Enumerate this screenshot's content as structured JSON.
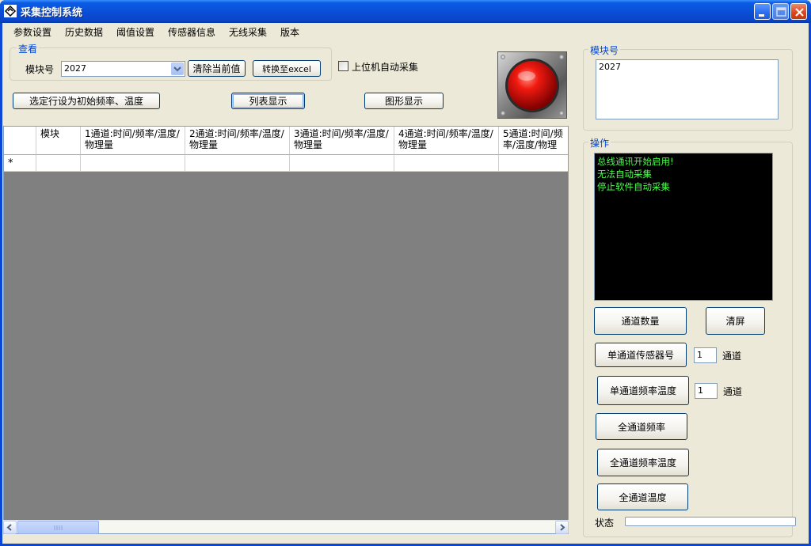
{
  "window": {
    "title": "采集控制系统"
  },
  "menu": [
    "参数设置",
    "历史数据",
    "阈值设置",
    "传感器信息",
    "无线采集",
    "版本"
  ],
  "view_group": {
    "label": "查看",
    "module_label": "模块号",
    "module_value": "2027",
    "clear_button": "清除当前值",
    "excel_button": "转换至excel",
    "auto_collect_label": "上位机自动采集",
    "auto_collect_checked": false
  },
  "buttons": {
    "set_initial": "选定行设为初始频率、温度",
    "list_view": "列表显示",
    "graph_view": "图形显示"
  },
  "grid": {
    "columns": [
      "模块",
      "1通道:时间/频率/温度/物理量",
      "2通道:时间/频率/温度/物理量",
      "3通道:时间/频率/温度/物理量",
      "4通道:时间/频率/温度/物理量",
      "5通道:时间/频率/温度/物理"
    ],
    "new_row_marker": "*"
  },
  "module_panel": {
    "label": "模块号",
    "value": "2027"
  },
  "operation": {
    "label": "操作",
    "log": [
      "总线通讯开始启用!",
      "无法自动采集",
      "停止软件自动采集"
    ],
    "channel_count_button": "通道数量",
    "clear_screen_button": "清屏",
    "single_sensor_button": "单通道传感器号",
    "single_sensor_value": "1",
    "single_sensor_unit": "通道",
    "single_freq_temp_button": "单通道频率温度",
    "single_freq_temp_value": "1",
    "single_freq_temp_unit": "通道",
    "all_freq_button": "全通道频率",
    "all_freq_temp_button": "全通道频率温度",
    "all_temp_button": "全通道温度"
  },
  "status": {
    "label": "状态"
  },
  "colors": {
    "log_text": "#4cff4c",
    "indicator": "#e01010",
    "group_label": "#0046d5"
  }
}
